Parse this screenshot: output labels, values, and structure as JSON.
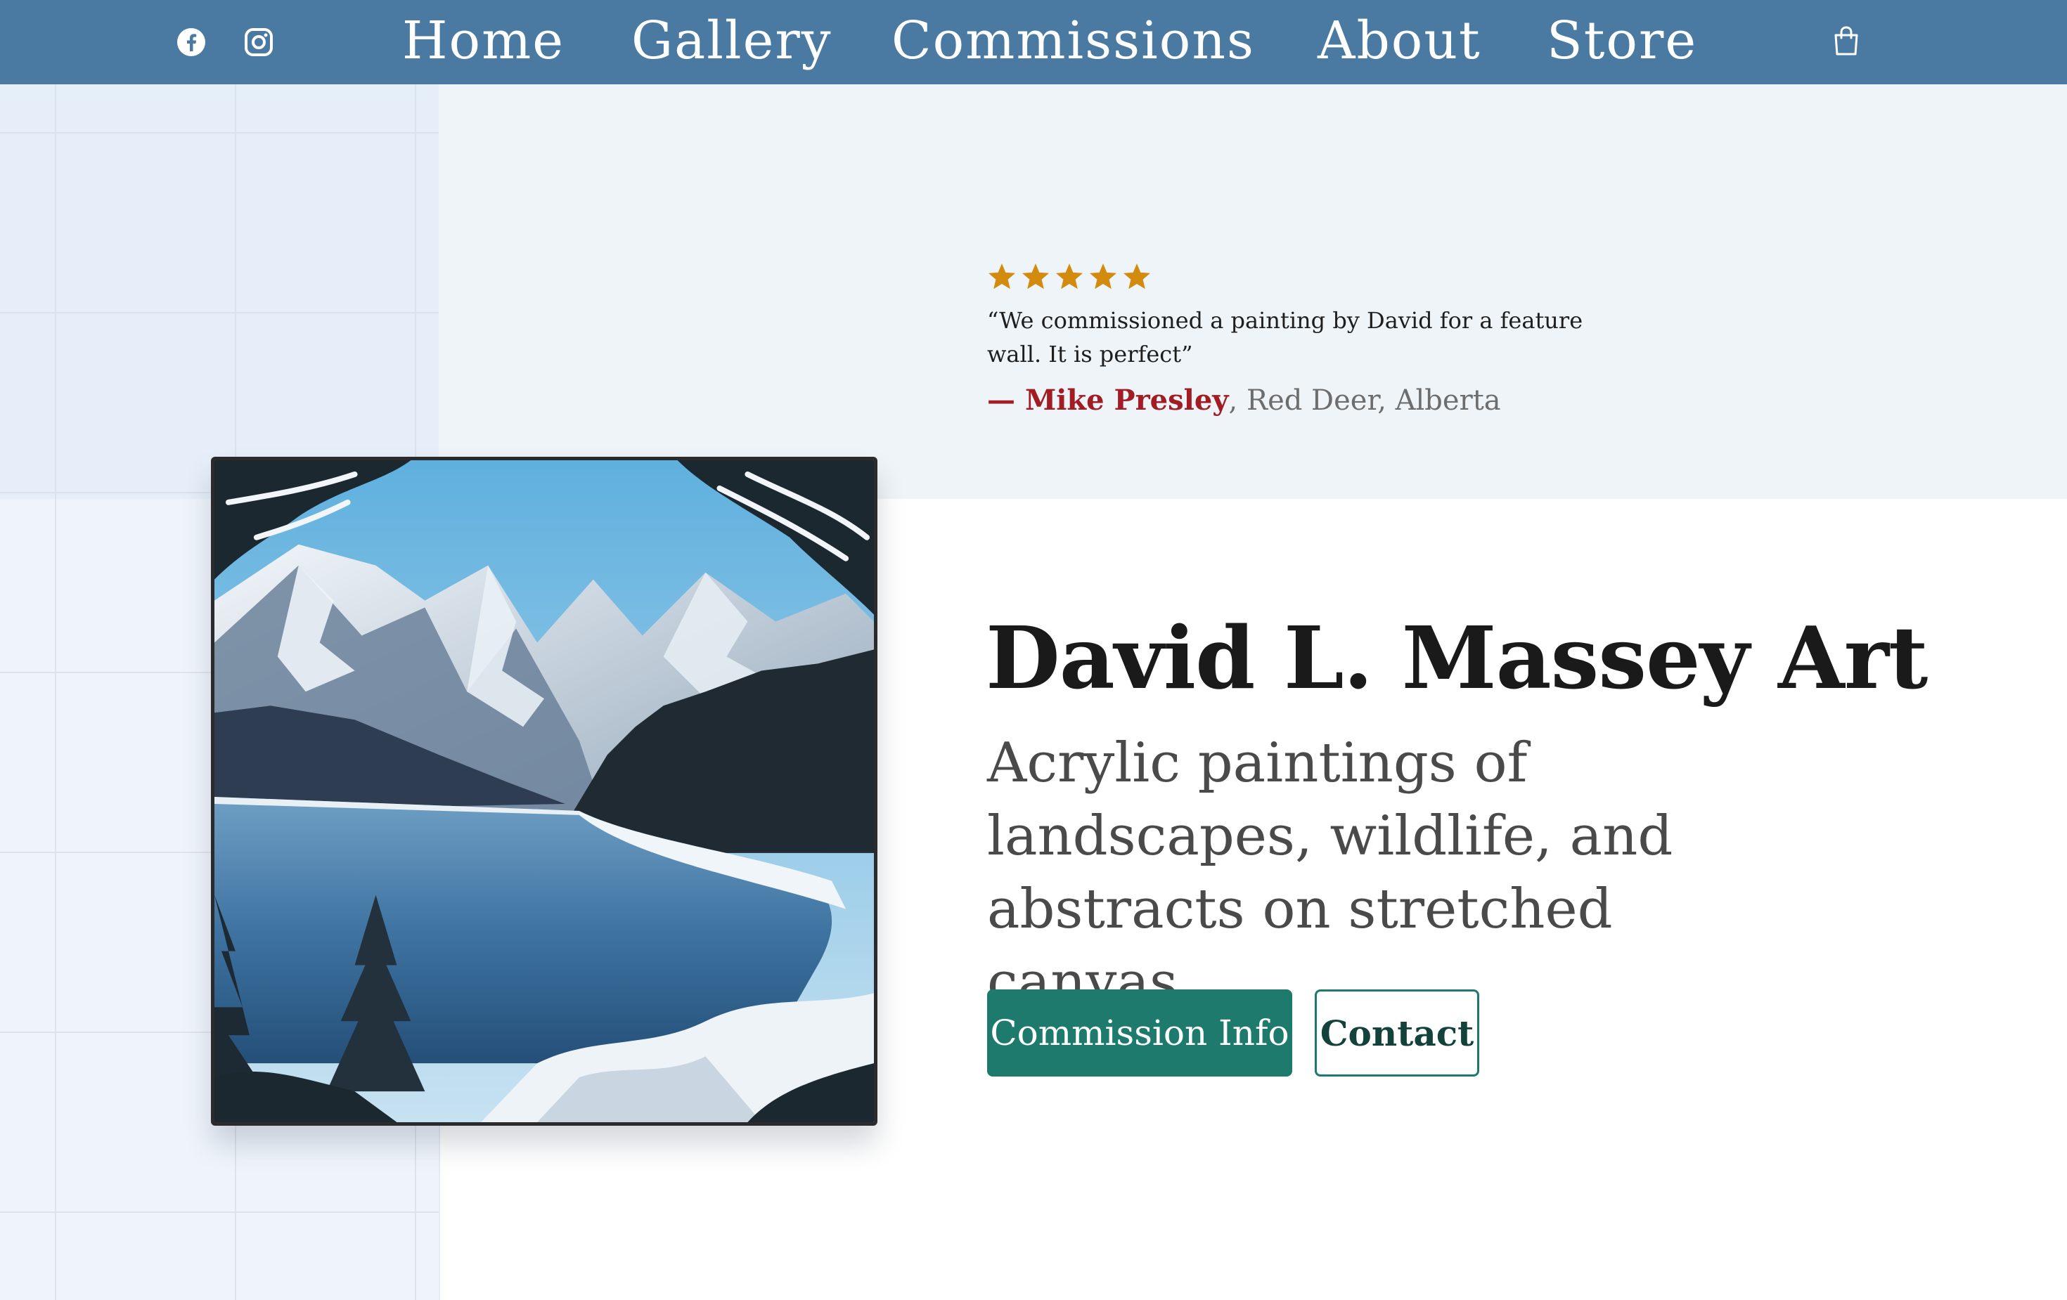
{
  "nav": {
    "social": [
      {
        "icon": "facebook-icon"
      },
      {
        "icon": "instagram-icon"
      }
    ],
    "links": {
      "home": "Home",
      "gallery": "Gallery",
      "commissions": "Commissions",
      "about": "About",
      "store": "Store"
    },
    "cart_icon": "shopping-bag-icon",
    "background": "#4a7aa1"
  },
  "testimonial": {
    "rating": 5,
    "rating_max": 5,
    "star_color": "#d48a0e",
    "quote": "“We commissioned a painting by David for a feature wall. It is perfect”",
    "dash": "— ",
    "author": "Mike Presley",
    "location": ", Red Deer, Alberta",
    "author_color": "#a11c23"
  },
  "hero": {
    "title": "David L. Massey Art",
    "subtitle": "Acrylic paintings of landscapes, wildlife, and abstracts on stretched canvas.",
    "primary_button": "Commission Info",
    "secondary_button": "Contact",
    "accent_color": "#1f7a6e"
  },
  "artwork": {
    "subject": "winter mountain lake painting"
  }
}
